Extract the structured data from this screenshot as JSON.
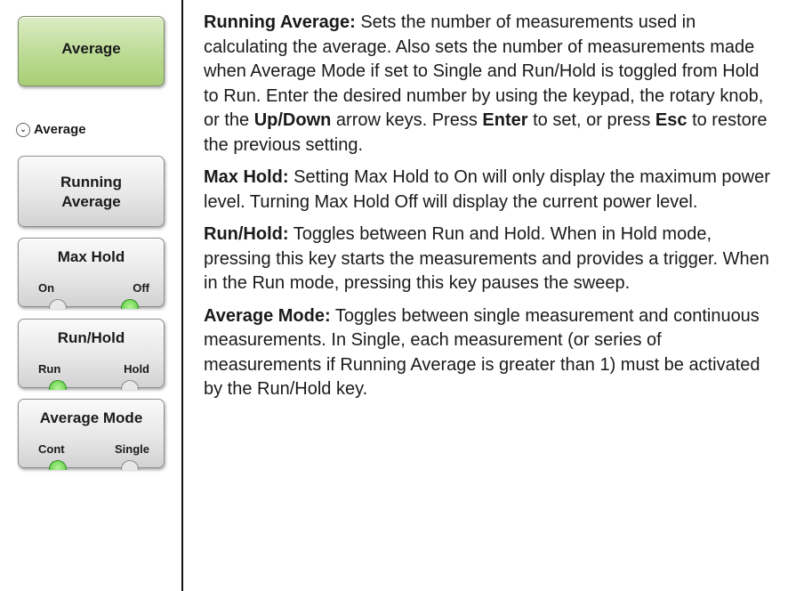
{
  "left_panel": {
    "main_button_label": "Average",
    "menu_title": "Average",
    "running_average": {
      "label_line1": "Running",
      "label_line2": "Average"
    },
    "max_hold": {
      "label": "Max Hold",
      "option_left": "On",
      "option_right": "Off",
      "active": "Off"
    },
    "run_hold": {
      "label": "Run/Hold",
      "option_left": "Run",
      "option_right": "Hold",
      "active": "Run"
    },
    "average_mode": {
      "label": "Average Mode",
      "option_left": "Cont",
      "option_right": "Single",
      "active": "Cont"
    }
  },
  "descriptions": {
    "running_average": {
      "heading": "Running Average:",
      "text_1": " Sets the number of measurements used in calculating the average. Also sets the number of measurements made when Average Mode if set to Single and Run/Hold is toggled from Hold to Run. Enter the desired number by using the keypad, the rotary knob, or the ",
      "key_updown": "Up/Down",
      "text_2": " arrow keys. Press ",
      "key_enter": "Enter",
      "text_3": " to set, or press ",
      "key_esc": "Esc",
      "text_4": " to restore the previous setting."
    },
    "max_hold": {
      "heading": "Max Hold:",
      "text": " Setting Max Hold to On will only display the maximum power level. Turning Max Hold Off will display the current power level."
    },
    "run_hold": {
      "heading": "Run/Hold:",
      "text": " Toggles between Run and Hold. When in Hold mode, pressing this key starts the measurements and provides a trigger. When in the Run mode, pressing this key pauses the sweep."
    },
    "average_mode": {
      "heading": "Average Mode:",
      "text": " Toggles between single measurement and continuous measurements. In Single, each measurement (or series of measurements if Running Average is greater than 1) must be activated by the Run/Hold key."
    }
  },
  "colors": {
    "active_led": "#53c93a",
    "main_button": "#b9d98f"
  }
}
